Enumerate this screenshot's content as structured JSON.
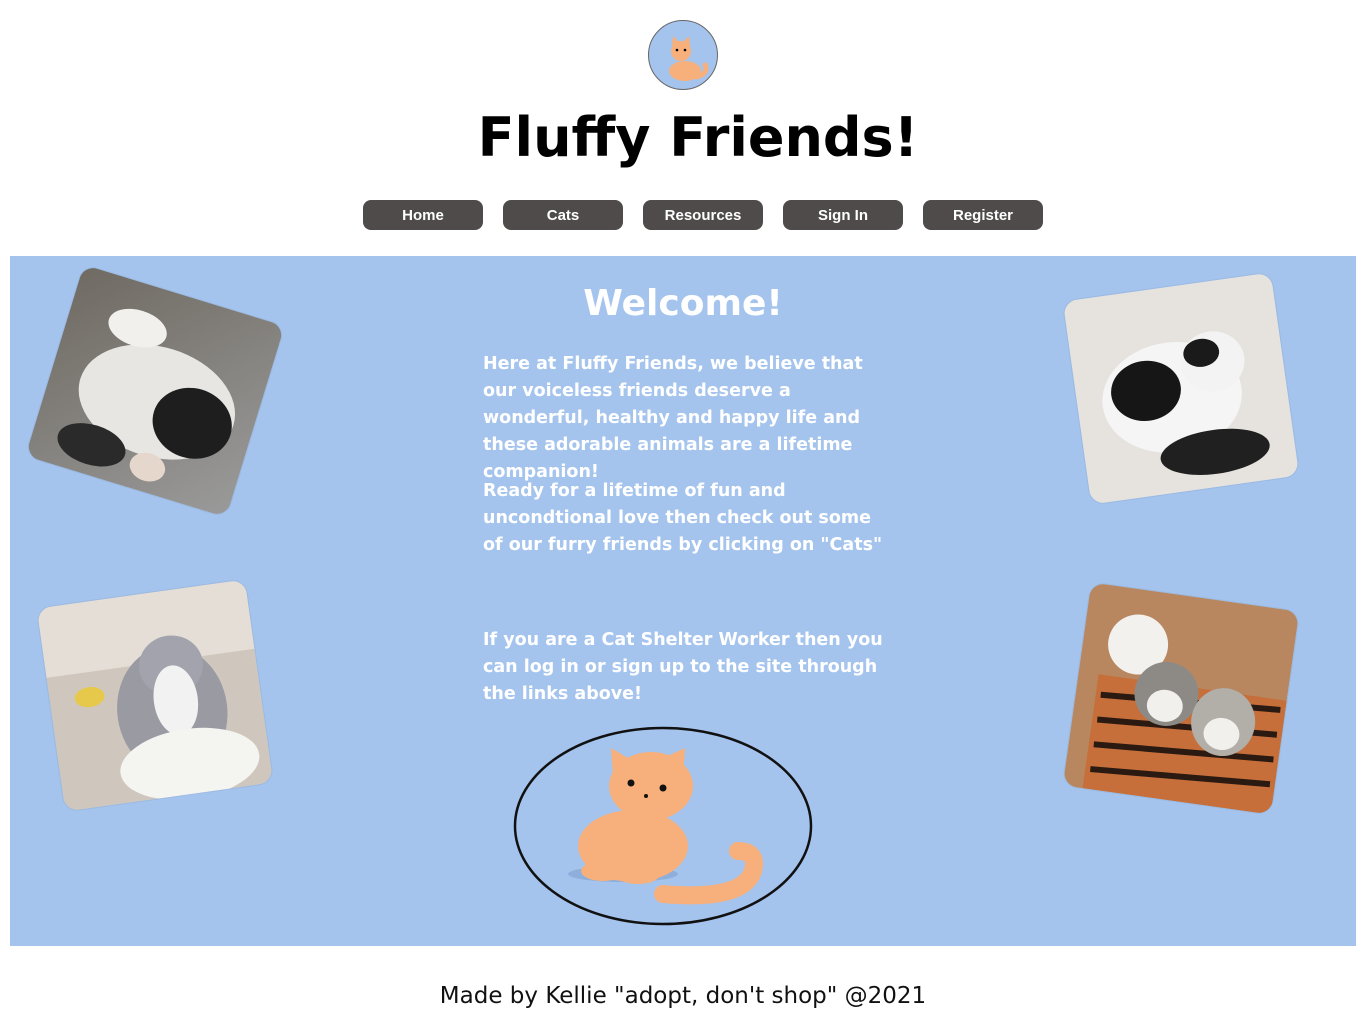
{
  "header": {
    "logo_icon": "cat-logo-icon",
    "title": "Fluffy Friends!"
  },
  "nav": {
    "items": [
      {
        "label": "Home"
      },
      {
        "label": "Cats"
      },
      {
        "label": "Resources"
      },
      {
        "label": "Sign In"
      },
      {
        "label": "Register"
      }
    ]
  },
  "main": {
    "heading": "Welcome!",
    "paragraphs": [
      "Here at Fluffy Friends, we believe that our voiceless friends deserve a wonderful, healthy and happy life and these adorable animals are a lifetime companion!",
      "Ready for a lifetime of fun and uncondtional love then check out some of our furry friends by clicking on \"Cats\"",
      "If you are a Cat Shelter Worker then you can log in or sign up to the site through the links above!"
    ],
    "photos": [
      "cat-photo-black-white-lying",
      "cat-photo-black-white-fluffy",
      "cat-photo-grey-white",
      "cat-photo-kittens"
    ],
    "illustration": "orange-cat-illustration"
  },
  "colors": {
    "panel": "#a4c4ee",
    "nav_button": "#4f4b4b",
    "cat_orange": "#f7b07c"
  },
  "footer": {
    "text": "Made by Kellie \"adopt, don't shop\" @2021"
  }
}
